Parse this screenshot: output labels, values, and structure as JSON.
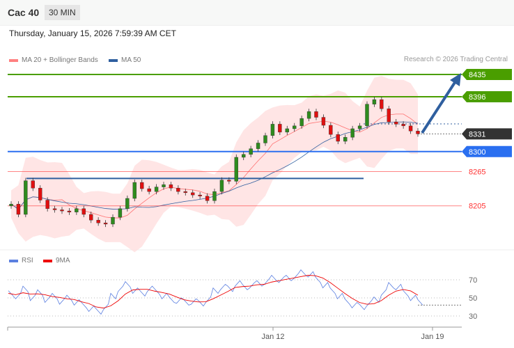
{
  "header": {
    "title": "Cac 40",
    "timeframe": "30 MIN"
  },
  "timestamp": "Thursday, January 15, 2026 7:59:39 AM CET",
  "legend": {
    "ma20": "MA 20 + Bollinger Bands",
    "ma50": "MA 50",
    "rsi": "RSI",
    "rsi_ma": "9MA"
  },
  "copyright": "Research © 2026 Trading Central",
  "colors": {
    "green": "#4a9e00",
    "blue": "#2a6ff0",
    "red": "#ff3333",
    "dark": "#333333",
    "arrow": "#2f5f9f"
  },
  "chart_data": {
    "type": "candlestick",
    "levels": [
      {
        "label": "8435",
        "value": 8435,
        "kind": "resistance"
      },
      {
        "label": "8396",
        "value": 8396,
        "kind": "resistance"
      },
      {
        "label": "8331",
        "value": 8331,
        "kind": "last"
      },
      {
        "label": "8300",
        "value": 8300,
        "kind": "pivot"
      },
      {
        "label": "8265",
        "value": 8265,
        "kind": "support"
      },
      {
        "label": "8205",
        "value": 8205,
        "kind": "support"
      }
    ],
    "trendline": 8253,
    "closes": [
      8208,
      8190,
      8249,
      8236,
      8215,
      8200,
      8198,
      8196,
      8194,
      8200,
      8190,
      8180,
      8175,
      8173,
      8185,
      8200,
      8218,
      8246,
      8235,
      8230,
      8238,
      8242,
      8236,
      8230,
      8228,
      8224,
      8222,
      8214,
      8230,
      8250,
      8248,
      8290,
      8295,
      8305,
      8315,
      8328,
      8348,
      8334,
      8340,
      8345,
      8358,
      8370,
      8360,
      8346,
      8330,
      8318,
      8325,
      8340,
      8345,
      8383,
      8391,
      8375,
      8352,
      8348,
      8345,
      8336,
      8331
    ],
    "rsi": [
      55,
      52,
      60,
      50,
      56,
      48,
      52,
      46,
      50,
      45,
      42,
      38,
      35,
      40,
      52,
      60,
      65,
      58,
      55,
      60,
      57,
      52,
      48,
      47,
      45,
      46,
      44,
      48,
      58,
      62,
      60,
      66,
      62,
      64,
      66,
      68,
      72,
      70,
      72,
      74,
      78,
      76,
      70,
      64,
      58,
      52,
      46,
      42,
      40,
      44,
      48,
      56,
      64,
      62,
      55,
      50,
      45
    ],
    "rsi_ticks": [
      "70",
      "50",
      "30"
    ],
    "x_ticks": [
      "Jan 12",
      "Jan 19"
    ],
    "ylim": [
      8160,
      8460
    ]
  }
}
